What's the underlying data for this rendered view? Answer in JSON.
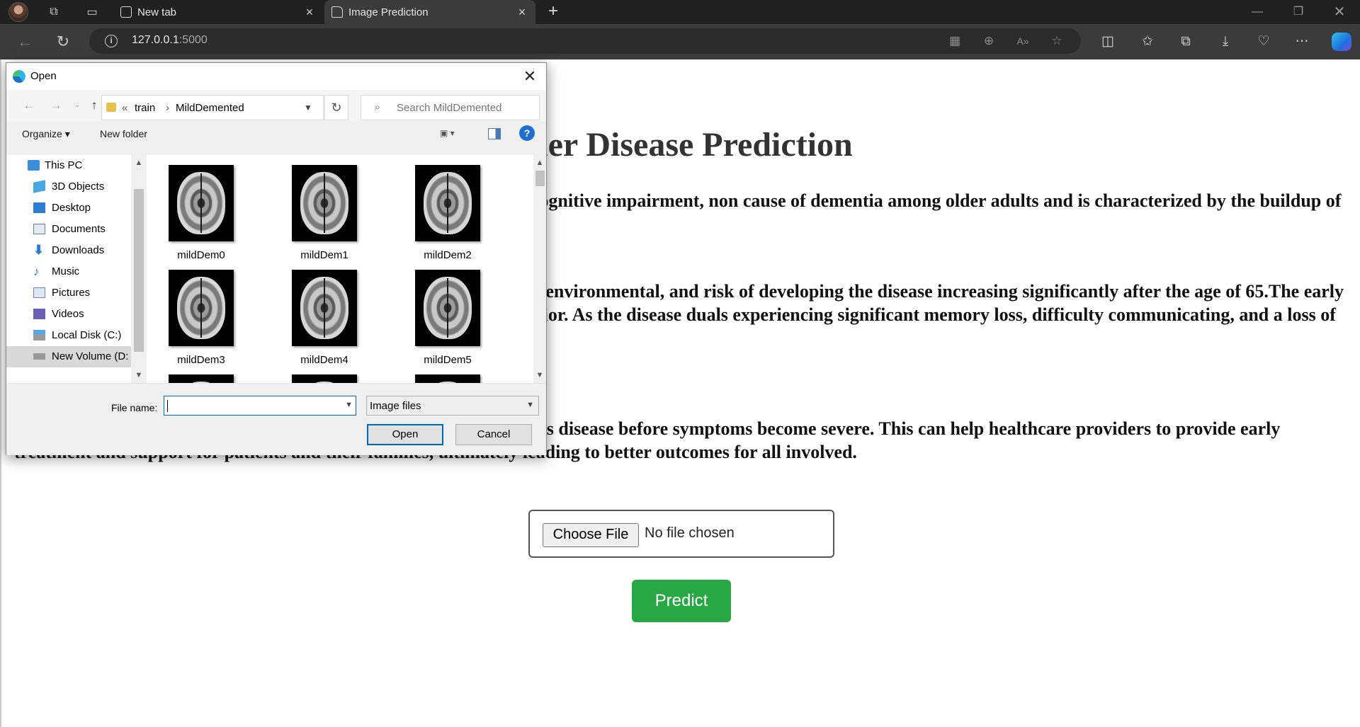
{
  "browser": {
    "tabs": [
      {
        "title": "New tab"
      },
      {
        "title": "Image Prediction"
      }
    ],
    "url": {
      "host": "127.0.0.1",
      "port": ":5000"
    }
  },
  "page": {
    "title": "imer Disease Prediction",
    "para1": "urological disorder that affects the brain, leading to memory loss, cognitive impairment, non cause of dementia among older adults and is characterized by the buildup of abnormal tau tangles.",
    "para2": "tood, but it is believed to be influenced by a combination of genetic, environmental, and risk of developing the disease increasing significantly after the age of 65.The early loss, difficulty with problem-solving, and changes in mood or behavior. As the disease duals experiencing significant memory loss, difficulty communicating, and a loss of the",
    "para3": "cal imaging data, it may be able to identify early signs of Alzheimer's disease before symptoms become severe. This can help healthcare providers to provide early treatment and support for patients and their families, ultimately leading to better outcomes for all involved.",
    "choose_file_label": "Choose File",
    "no_file_text": "No file chosen",
    "predict_label": "Predict",
    "predict_color": "#28a745"
  },
  "dialog": {
    "title": "Open",
    "breadcrumb": [
      "«",
      "train",
      "›",
      "MildDemented"
    ],
    "search_placeholder": "Search MildDemented",
    "organize_label": "Organize ▾",
    "new_folder_label": "New folder",
    "nav_items": [
      {
        "label": "This PC",
        "icon": "pc-icon"
      },
      {
        "label": "3D Objects",
        "icon": "3d-objects-icon"
      },
      {
        "label": "Desktop",
        "icon": "desktop-icon"
      },
      {
        "label": "Documents",
        "icon": "documents-icon"
      },
      {
        "label": "Downloads",
        "icon": "downloads-icon"
      },
      {
        "label": "Music",
        "icon": "music-icon"
      },
      {
        "label": "Pictures",
        "icon": "pictures-icon"
      },
      {
        "label": "Videos",
        "icon": "videos-icon"
      },
      {
        "label": "Local Disk (C:)",
        "icon": "drive-icon"
      },
      {
        "label": "New Volume (D:",
        "icon": "drive-icon"
      }
    ],
    "files": [
      "mildDem0",
      "mildDem1",
      "mildDem2",
      "mildDem3",
      "mildDem4",
      "mildDem5"
    ],
    "filename_label": "File name:",
    "filename_value": "",
    "filetype_value": "Image files",
    "open_label": "Open",
    "cancel_label": "Cancel"
  }
}
